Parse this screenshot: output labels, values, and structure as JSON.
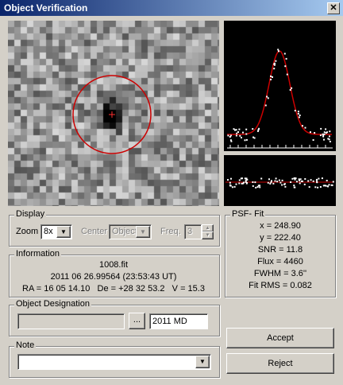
{
  "window": {
    "title": "Object Verification",
    "close_glyph": "✕"
  },
  "image_view": {
    "icon": "target-crosshair-icon"
  },
  "display": {
    "legend": "Display",
    "zoom_label": "Zoom",
    "zoom_value": "8x",
    "center_label": "Center",
    "center_value": "Object",
    "freq_label": "Freq.",
    "freq_value": "3"
  },
  "information": {
    "legend": "Information",
    "filename": "1008.fit",
    "datetime": "2011 06 26.99564 (23:53:43 UT)",
    "coords": "RA = 16 05 14.10   De = +28 32 53.2   V = 15.3"
  },
  "designation": {
    "legend": "Object Designation",
    "browse_label": "...",
    "value": "2011 MD"
  },
  "note": {
    "legend": "Note",
    "value": ""
  },
  "psf_fit": {
    "legend": "PSF- Fit",
    "x": "x = 248.90",
    "y": "y = 222.40",
    "snr": "SNR = 11.8",
    "flux": "Flux = 4460",
    "fwhm": "FWHM = 3.6''",
    "fit_rms": "Fit RMS = 0.082"
  },
  "buttons": {
    "accept": "Accept",
    "reject": "Reject"
  },
  "colors": {
    "curve": "#cc0000",
    "points": "#ffffff",
    "plot_bg": "#000000"
  }
}
